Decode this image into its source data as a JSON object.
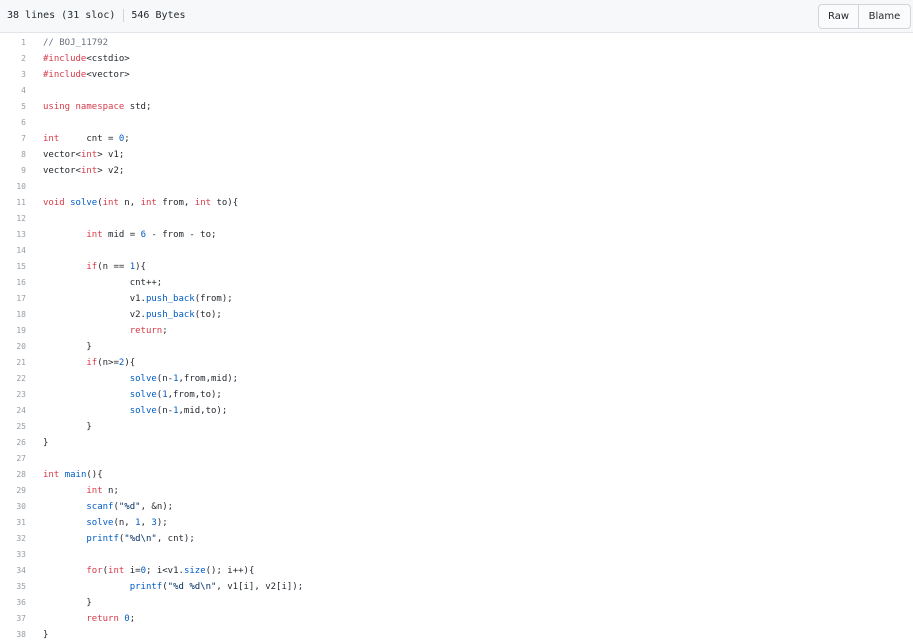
{
  "file_info": {
    "lines": "38 lines (31 sloc)",
    "size": "546 Bytes"
  },
  "buttons": {
    "raw": "Raw",
    "blame": "Blame"
  },
  "colors": {
    "keyword": "#d73a49",
    "function": "#005cc5",
    "number": "#005cc5",
    "string": "#032f62",
    "comment": "#6a737d",
    "text": "#24292e"
  },
  "code_lines": [
    {
      "n": "1",
      "tokens": [
        [
          "cm",
          "// BOJ_11792"
        ]
      ]
    },
    {
      "n": "2",
      "tokens": [
        [
          "kw",
          "#include"
        ],
        [
          "t",
          "<cstdio>"
        ]
      ]
    },
    {
      "n": "3",
      "tokens": [
        [
          "kw",
          "#include"
        ],
        [
          "t",
          "<vector>"
        ]
      ]
    },
    {
      "n": "4",
      "tokens": []
    },
    {
      "n": "5",
      "tokens": [
        [
          "kw",
          "using"
        ],
        [
          "t",
          " "
        ],
        [
          "kw",
          "namespace"
        ],
        [
          "t",
          " std;"
        ]
      ]
    },
    {
      "n": "6",
      "tokens": []
    },
    {
      "n": "7",
      "tokens": [
        [
          "kw",
          "int"
        ],
        [
          "t",
          "     cnt = "
        ],
        [
          "num",
          "0"
        ],
        [
          "t",
          ";"
        ]
      ]
    },
    {
      "n": "8",
      "tokens": [
        [
          "t",
          "vector<"
        ],
        [
          "kw",
          "int"
        ],
        [
          "t",
          "> v1;"
        ]
      ]
    },
    {
      "n": "9",
      "tokens": [
        [
          "t",
          "vector<"
        ],
        [
          "kw",
          "int"
        ],
        [
          "t",
          "> v2;"
        ]
      ]
    },
    {
      "n": "10",
      "tokens": []
    },
    {
      "n": "11",
      "tokens": [
        [
          "kw",
          "void"
        ],
        [
          "t",
          " "
        ],
        [
          "fn",
          "solve"
        ],
        [
          "t",
          "("
        ],
        [
          "kw",
          "int"
        ],
        [
          "t",
          " n, "
        ],
        [
          "kw",
          "int"
        ],
        [
          "t",
          " from, "
        ],
        [
          "kw",
          "int"
        ],
        [
          "t",
          " to){"
        ]
      ]
    },
    {
      "n": "12",
      "tokens": []
    },
    {
      "n": "13",
      "tokens": [
        [
          "t",
          "        "
        ],
        [
          "kw",
          "int"
        ],
        [
          "t",
          " mid = "
        ],
        [
          "num",
          "6"
        ],
        [
          "t",
          " - from - to;"
        ]
      ]
    },
    {
      "n": "14",
      "tokens": []
    },
    {
      "n": "15",
      "tokens": [
        [
          "t",
          "        "
        ],
        [
          "kw",
          "if"
        ],
        [
          "t",
          "(n == "
        ],
        [
          "num",
          "1"
        ],
        [
          "t",
          "){"
        ]
      ]
    },
    {
      "n": "16",
      "tokens": [
        [
          "t",
          "                cnt++;"
        ]
      ]
    },
    {
      "n": "17",
      "tokens": [
        [
          "t",
          "                v1."
        ],
        [
          "fn",
          "push_back"
        ],
        [
          "t",
          "(from);"
        ]
      ]
    },
    {
      "n": "18",
      "tokens": [
        [
          "t",
          "                v2."
        ],
        [
          "fn",
          "push_back"
        ],
        [
          "t",
          "(to);"
        ]
      ]
    },
    {
      "n": "19",
      "tokens": [
        [
          "t",
          "                "
        ],
        [
          "kw",
          "return"
        ],
        [
          "t",
          ";"
        ]
      ]
    },
    {
      "n": "20",
      "tokens": [
        [
          "t",
          "        }"
        ]
      ]
    },
    {
      "n": "21",
      "tokens": [
        [
          "t",
          "        "
        ],
        [
          "kw",
          "if"
        ],
        [
          "t",
          "(n>="
        ],
        [
          "num",
          "2"
        ],
        [
          "t",
          "){"
        ]
      ]
    },
    {
      "n": "22",
      "tokens": [
        [
          "t",
          "                "
        ],
        [
          "fn",
          "solve"
        ],
        [
          "t",
          "(n-"
        ],
        [
          "num",
          "1"
        ],
        [
          "t",
          ",from,mid);"
        ]
      ]
    },
    {
      "n": "23",
      "tokens": [
        [
          "t",
          "                "
        ],
        [
          "fn",
          "solve"
        ],
        [
          "t",
          "("
        ],
        [
          "num",
          "1"
        ],
        [
          "t",
          ",from,to);"
        ]
      ]
    },
    {
      "n": "24",
      "tokens": [
        [
          "t",
          "                "
        ],
        [
          "fn",
          "solve"
        ],
        [
          "t",
          "(n-"
        ],
        [
          "num",
          "1"
        ],
        [
          "t",
          ",mid,to);"
        ]
      ]
    },
    {
      "n": "25",
      "tokens": [
        [
          "t",
          "        }"
        ]
      ]
    },
    {
      "n": "26",
      "tokens": [
        [
          "t",
          "}"
        ]
      ]
    },
    {
      "n": "27",
      "tokens": []
    },
    {
      "n": "28",
      "tokens": [
        [
          "kw",
          "int"
        ],
        [
          "t",
          " "
        ],
        [
          "fn",
          "main"
        ],
        [
          "t",
          "(){"
        ]
      ]
    },
    {
      "n": "29",
      "tokens": [
        [
          "t",
          "        "
        ],
        [
          "kw",
          "int"
        ],
        [
          "t",
          " n;"
        ]
      ]
    },
    {
      "n": "30",
      "tokens": [
        [
          "t",
          "        "
        ],
        [
          "fn",
          "scanf"
        ],
        [
          "t",
          "("
        ],
        [
          "str",
          "\"%d\""
        ],
        [
          "t",
          ", &n);"
        ]
      ]
    },
    {
      "n": "31",
      "tokens": [
        [
          "t",
          "        "
        ],
        [
          "fn",
          "solve"
        ],
        [
          "t",
          "(n, "
        ],
        [
          "num",
          "1"
        ],
        [
          "t",
          ", "
        ],
        [
          "num",
          "3"
        ],
        [
          "t",
          ");"
        ]
      ]
    },
    {
      "n": "32",
      "tokens": [
        [
          "t",
          "        "
        ],
        [
          "fn",
          "printf"
        ],
        [
          "t",
          "("
        ],
        [
          "str",
          "\"%d\\n\""
        ],
        [
          "t",
          ", cnt);"
        ]
      ]
    },
    {
      "n": "33",
      "tokens": []
    },
    {
      "n": "34",
      "tokens": [
        [
          "t",
          "        "
        ],
        [
          "kw",
          "for"
        ],
        [
          "t",
          "("
        ],
        [
          "kw",
          "int"
        ],
        [
          "t",
          " i="
        ],
        [
          "num",
          "0"
        ],
        [
          "t",
          "; i<v1."
        ],
        [
          "fn",
          "size"
        ],
        [
          "t",
          "(); i++){"
        ]
      ]
    },
    {
      "n": "35",
      "tokens": [
        [
          "t",
          "                "
        ],
        [
          "fn",
          "printf"
        ],
        [
          "t",
          "("
        ],
        [
          "str",
          "\"%d %d\\n\""
        ],
        [
          "t",
          ", v1[i], v2[i]);"
        ]
      ]
    },
    {
      "n": "36",
      "tokens": [
        [
          "t",
          "        }"
        ]
      ]
    },
    {
      "n": "37",
      "tokens": [
        [
          "t",
          "        "
        ],
        [
          "kw",
          "return"
        ],
        [
          "t",
          " "
        ],
        [
          "num",
          "0"
        ],
        [
          "t",
          ";"
        ]
      ]
    },
    {
      "n": "38",
      "tokens": [
        [
          "t",
          "}"
        ]
      ]
    }
  ]
}
